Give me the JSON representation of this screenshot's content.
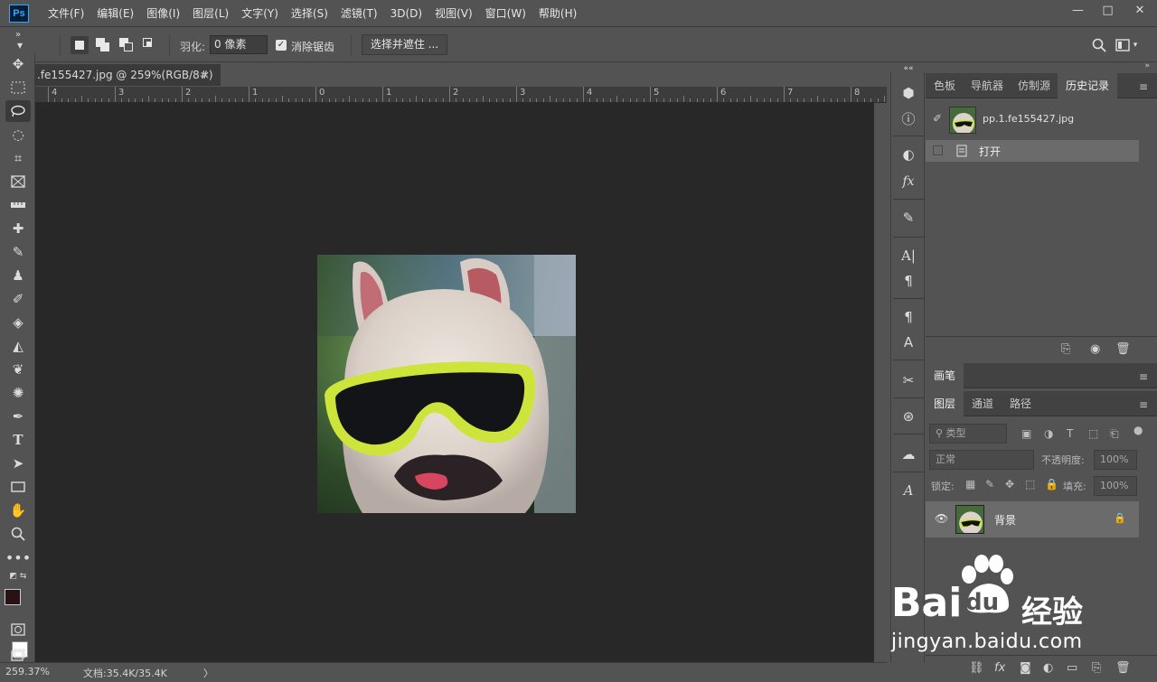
{
  "app": {
    "logo_text": "Ps"
  },
  "menu": [
    "文件(F)",
    "编辑(E)",
    "图像(I)",
    "图层(L)",
    "文字(Y)",
    "选择(S)",
    "滤镜(T)",
    "3D(D)",
    "视图(V)",
    "窗口(W)",
    "帮助(H)"
  ],
  "window_controls": {
    "minimize": "—",
    "maximize": "□",
    "close": "✕"
  },
  "options": {
    "feather_label": "羽化:",
    "feather_value": "0 像素",
    "antialias_checked": true,
    "antialias_label": "消除锯齿",
    "select_mask_label": "选择并遮住 ..."
  },
  "document": {
    "tab_title": ".fe155427.jpg @ 259%(RGB/8#)",
    "tab_close": "×",
    "ruler_labels": [
      "4",
      "3",
      "2",
      "1",
      "0",
      "1",
      "2",
      "3",
      "4",
      "5",
      "6",
      "7",
      "8"
    ]
  },
  "status": {
    "zoom": "259.37%",
    "doc_size": "文档:35.4K/35.4K",
    "arrow": "〉"
  },
  "history_panel": {
    "tabs": [
      "色板",
      "导航器",
      "仿制源",
      "历史记录"
    ],
    "active_tab": "历史记录",
    "snapshot_name": "pp.1.fe155427.jpg",
    "items": [
      "打开"
    ]
  },
  "brush_panel": {
    "tab": "画笔"
  },
  "layers_panel": {
    "tabs": [
      "图层",
      "通道",
      "路径"
    ],
    "active_tab": "图层",
    "filter_placeholder": "类型",
    "blend_mode": "正常",
    "opacity_label": "不透明度:",
    "opacity_value": "100%",
    "lock_label": "锁定:",
    "fill_label": "填充:",
    "fill_value": "100%",
    "layers": [
      {
        "name": "背景",
        "visible": true,
        "locked": true
      }
    ]
  },
  "watermark": {
    "brand": "Bai",
    "brand2": "du",
    "product": "经验",
    "url": "jingyan.baidu.com"
  }
}
